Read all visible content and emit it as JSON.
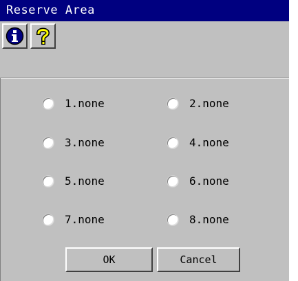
{
  "window": {
    "title": "Reserve Area"
  },
  "toolbar": {
    "info_icon": "info-icon",
    "help_icon": "help-icon"
  },
  "options": [
    {
      "label": "1.none",
      "selected": false
    },
    {
      "label": "2.none",
      "selected": false
    },
    {
      "label": "3.none",
      "selected": false
    },
    {
      "label": "4.none",
      "selected": false
    },
    {
      "label": "5.none",
      "selected": false
    },
    {
      "label": "6.none",
      "selected": false
    },
    {
      "label": "7.none",
      "selected": false
    },
    {
      "label": "8.none",
      "selected": false
    }
  ],
  "buttons": {
    "ok_label": "OK",
    "cancel_label": "Cancel"
  },
  "colors": {
    "titlebar": "#000080",
    "face": "#c0c0c0",
    "help_icon": "#ffff00"
  }
}
